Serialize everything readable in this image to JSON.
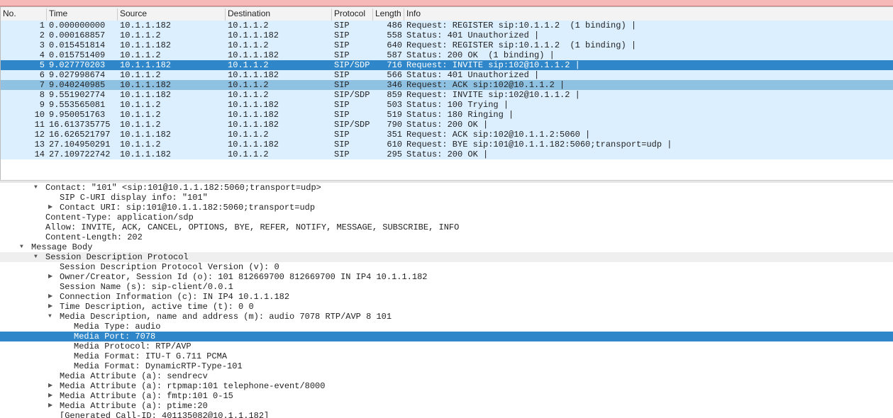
{
  "columns": [
    "No.",
    "Time",
    "Source",
    "Destination",
    "Protocol",
    "Length",
    "Info"
  ],
  "packets": [
    [
      "1",
      "0.000000000",
      "10.1.1.182",
      "10.1.1.2",
      "SIP",
      "486",
      "Request: REGISTER sip:10.1.1.2  (1 binding) |"
    ],
    [
      "2",
      "0.000168857",
      "10.1.1.2",
      "10.1.1.182",
      "SIP",
      "558",
      "Status: 401 Unauthorized |"
    ],
    [
      "3",
      "0.015451814",
      "10.1.1.182",
      "10.1.1.2",
      "SIP",
      "640",
      "Request: REGISTER sip:10.1.1.2  (1 binding) |"
    ],
    [
      "4",
      "0.015751409",
      "10.1.1.2",
      "10.1.1.182",
      "SIP",
      "587",
      "Status: 200 OK  (1 binding) |"
    ],
    [
      "5",
      "9.027770203",
      "10.1.1.182",
      "10.1.1.2",
      "SIP/SDP",
      "716",
      "Request: INVITE sip:102@10.1.1.2 |"
    ],
    [
      "6",
      "9.027998674",
      "10.1.1.2",
      "10.1.1.182",
      "SIP",
      "566",
      "Status: 401 Unauthorized |"
    ],
    [
      "7",
      "9.040240985",
      "10.1.1.182",
      "10.1.1.2",
      "SIP",
      "346",
      "Request: ACK sip:102@10.1.1.2 |"
    ],
    [
      "8",
      "9.551902774",
      "10.1.1.182",
      "10.1.1.2",
      "SIP/SDP",
      "859",
      "Request: INVITE sip:102@10.1.1.2 |"
    ],
    [
      "9",
      "9.553565081",
      "10.1.1.2",
      "10.1.1.182",
      "SIP",
      "503",
      "Status: 100 Trying |"
    ],
    [
      "10",
      "9.950051763",
      "10.1.1.2",
      "10.1.1.182",
      "SIP",
      "519",
      "Status: 180 Ringing |"
    ],
    [
      "11",
      "16.613735775",
      "10.1.1.2",
      "10.1.1.182",
      "SIP/SDP",
      "790",
      "Status: 200 OK |"
    ],
    [
      "12",
      "16.626521797",
      "10.1.1.182",
      "10.1.1.2",
      "SIP",
      "351",
      "Request: ACK sip:102@10.1.1.2:5060 |"
    ],
    [
      "13",
      "27.104950291",
      "10.1.1.2",
      "10.1.1.182",
      "SIP",
      "610",
      "Request: BYE sip:101@10.1.1.182:5060;transport=udp |"
    ],
    [
      "14",
      "27.109722742",
      "10.1.1.182",
      "10.1.1.2",
      "SIP",
      "295",
      "Status: 200 OK |"
    ]
  ],
  "selected_packet": "5",
  "details": [
    {
      "text": "Contact: \"101\" <sip:101@10.1.1.182:5060;transport=udp>",
      "level": 2,
      "state": "expanded"
    },
    {
      "text": "SIP C-URI display info: \"101\"",
      "level": 3,
      "state": "leaf"
    },
    {
      "text": "Contact URI: sip:101@10.1.1.182:5060;transport=udp",
      "level": 3,
      "state": "collapsed"
    },
    {
      "text": "Content-Type: application/sdp",
      "level": 2,
      "state": "leaf"
    },
    {
      "text": "Allow: INVITE, ACK, CANCEL, OPTIONS, BYE, REFER, NOTIFY, MESSAGE, SUBSCRIBE, INFO",
      "level": 2,
      "state": "leaf"
    },
    {
      "text": "Content-Length: 202",
      "level": 2,
      "state": "leaf"
    },
    {
      "text": "Message Body",
      "level": 1,
      "state": "expanded"
    },
    {
      "text": "Session Description Protocol",
      "level": 2,
      "state": "expanded",
      "hl": true
    },
    {
      "text": "Session Description Protocol Version (v): 0",
      "level": 4,
      "state": "leaf"
    },
    {
      "text": "Owner/Creator, Session Id (o): 101 812669700 812669700 IN IP4 10.1.1.182",
      "level": 3,
      "state": "collapsed"
    },
    {
      "text": "Session Name (s): sip-client/0.0.1",
      "level": 3,
      "state": "leaf"
    },
    {
      "text": "Connection Information (c): IN IP4 10.1.1.182",
      "level": 3,
      "state": "collapsed"
    },
    {
      "text": "Time Description, active time (t): 0 0",
      "level": 3,
      "state": "collapsed"
    },
    {
      "text": "Media Description, name and address (m): audio 7078 RTP/AVP 8 101",
      "level": 3,
      "state": "expanded"
    },
    {
      "text": "Media Type: audio",
      "level": 5,
      "state": "leaf"
    },
    {
      "text": "Media Port: 7078",
      "level": 5,
      "state": "leaf",
      "selected": true
    },
    {
      "text": "Media Protocol: RTP/AVP",
      "level": 5,
      "state": "leaf"
    },
    {
      "text": "Media Format: ITU-T G.711 PCMA",
      "level": 5,
      "state": "leaf"
    },
    {
      "text": "Media Format: DynamicRTP-Type-101",
      "level": 5,
      "state": "leaf"
    },
    {
      "text": "Media Attribute (a): sendrecv",
      "level": 4,
      "state": "leaf"
    },
    {
      "text": "Media Attribute (a): rtpmap:101 telephone-event/8000",
      "level": 3,
      "state": "collapsed"
    },
    {
      "text": "Media Attribute (a): fmtp:101 0-15",
      "level": 3,
      "state": "collapsed"
    },
    {
      "text": "Media Attribute (a): ptime:20",
      "level": 3,
      "state": "collapsed"
    },
    {
      "text": "[Generated Call-ID: 401135082@10.1.1.182]",
      "level": 4,
      "state": "leaf"
    }
  ],
  "colors": {
    "row_bg": "#dcefff",
    "selected": "#2f86c8",
    "related": "#8fc1e2",
    "filter_bar": "#f7b8b8"
  }
}
